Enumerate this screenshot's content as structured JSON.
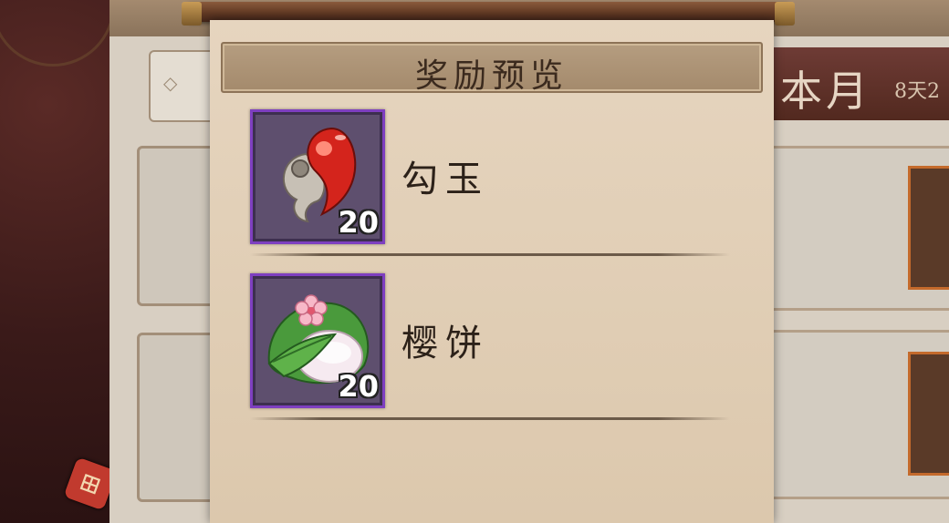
{
  "background": {
    "month_label": "本月",
    "days_label": "8天2",
    "corner_icon": "seal-icon"
  },
  "dialog": {
    "title": "奖励预览",
    "rewards": [
      {
        "name": "勾玉",
        "count": "20",
        "icon": "magatama-icon"
      },
      {
        "name": "樱饼",
        "count": "20",
        "icon": "sakura-mochi-icon"
      }
    ]
  },
  "colors": {
    "panel": "#e2cfb6",
    "title_bar": "#ad947a",
    "item_border_epic": "#7e3fc0",
    "item_bg": "#5e4f6e"
  }
}
